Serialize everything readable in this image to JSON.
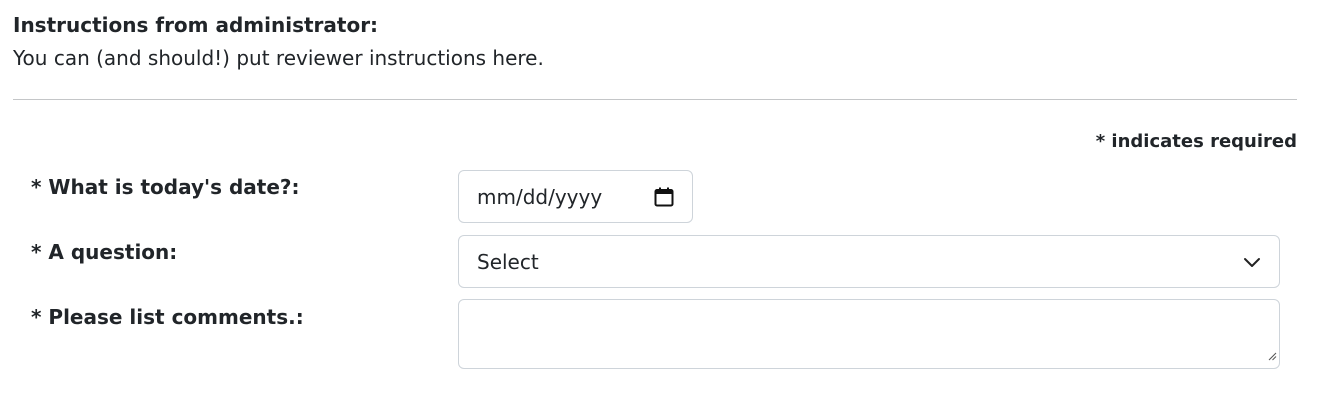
{
  "instructions": {
    "heading": "Instructions from administrator:",
    "text": "You can (and should!) put reviewer instructions here."
  },
  "required_note": "* indicates required",
  "fields": {
    "date": {
      "label": "* What is today's date?:",
      "placeholder": "mm/dd/yyyy",
      "icon": "calendar-icon"
    },
    "question": {
      "label": "* A question:",
      "selected": "Select",
      "icon": "chevron-down-icon"
    },
    "comments": {
      "label": "* Please list comments.:",
      "value": ""
    }
  },
  "colors": {
    "text": "#212529",
    "border": "#ced4da",
    "divider": "#c4c6c8",
    "background": "#ffffff"
  }
}
